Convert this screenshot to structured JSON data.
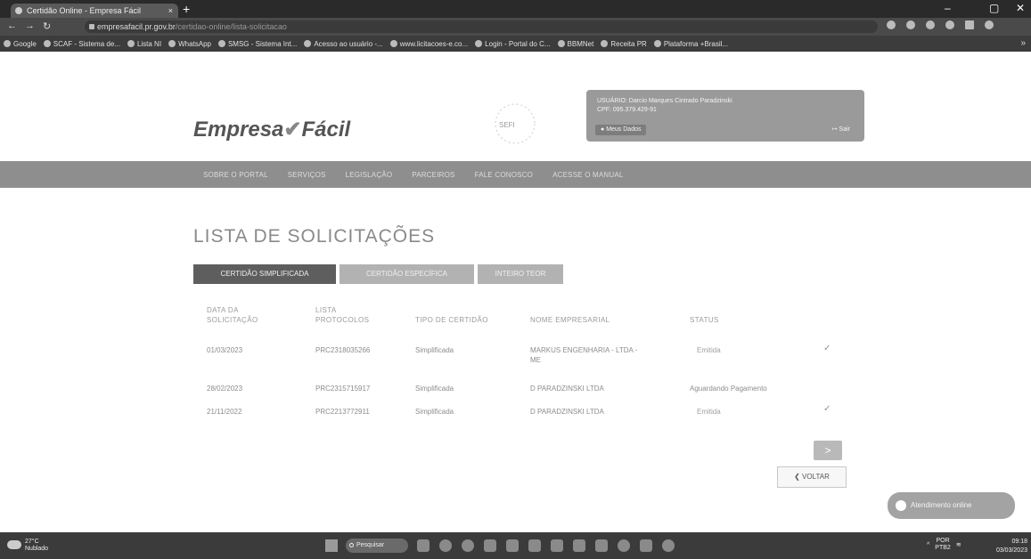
{
  "browser": {
    "tab_title": "Certidão Online - Empresa Fácil",
    "new_tab": "+",
    "url_host": "empresafacil.pr.gov.br",
    "url_path": "/certidao-online/lista-solicitacao",
    "bookmarks": [
      "Google",
      "SCAF - Sistema de...",
      "Lista NI",
      "WhatsApp",
      "SMSG - Sistema Int...",
      "Acesso ao usuário -...",
      "www.licitacoes-e.co...",
      "Login - Portal do C...",
      "BBMNet",
      "Receita PR",
      "Plataforma +Brasil..."
    ]
  },
  "header": {
    "logo_text": "Empresa",
    "logo_text2": "Fácil",
    "seal_text": "SEFI",
    "user_label": "USUÁRIO: Darcio Marques Cintrado Paradzinski",
    "cpf_label": "CPF: 095.379.429-91",
    "meus_dados": "Meus Dados",
    "sair": "Sair"
  },
  "menu": {
    "items": [
      "SOBRE O PORTAL",
      "SERVIÇOS",
      "LEGISLAÇÃO",
      "PARCEIROS",
      "FALE CONOSCO",
      "ACESSE O MANUAL"
    ]
  },
  "content": {
    "title": "LISTA DE SOLICITAÇÕES",
    "tabs": [
      "CERTIDÃO SIMPLIFICADA",
      "CERTIDÃO ESPECÍFICA",
      "INTEIRO TEOR"
    ],
    "columns": {
      "c1": [
        "DATA DA",
        "SOLICITAÇÃO"
      ],
      "c2": [
        "LISTA",
        "PROTOCOLOS"
      ],
      "c3": "TIPO DE CERTIDÃO",
      "c4": "NOME EMPRESARIAL",
      "c5": "STATUS"
    },
    "rows": [
      {
        "date": "01/03/2023",
        "protocol": "PRC2318035266",
        "type": "Simplificada",
        "name1": "MARKUS ENGENHARIA - LTDA -",
        "name2": "ME",
        "status": "Emitida",
        "check": "✓"
      },
      {
        "date": "28/02/2023",
        "protocol": "PRC2315715917",
        "type": "Simplificada",
        "name1": "D PARADZINSKI LTDA",
        "name2": "",
        "status": "Aguardando Pagamento",
        "check": ""
      },
      {
        "date": "21/11/2022",
        "protocol": "PRC2213772911",
        "type": "Simplificada",
        "name1": "D PARADZINSKI LTDA",
        "name2": "",
        "status": "Emitida",
        "check": "✓"
      }
    ],
    "next_label": ">",
    "back_label": "VOLTAR",
    "chat_label": "Atendimento online"
  },
  "taskbar": {
    "temp": "27°C",
    "weather": "Nublado",
    "search": "Pesquisar",
    "lang1": "POR",
    "lang2": "PTB2",
    "time": "09:18",
    "date": "03/03/2023"
  }
}
